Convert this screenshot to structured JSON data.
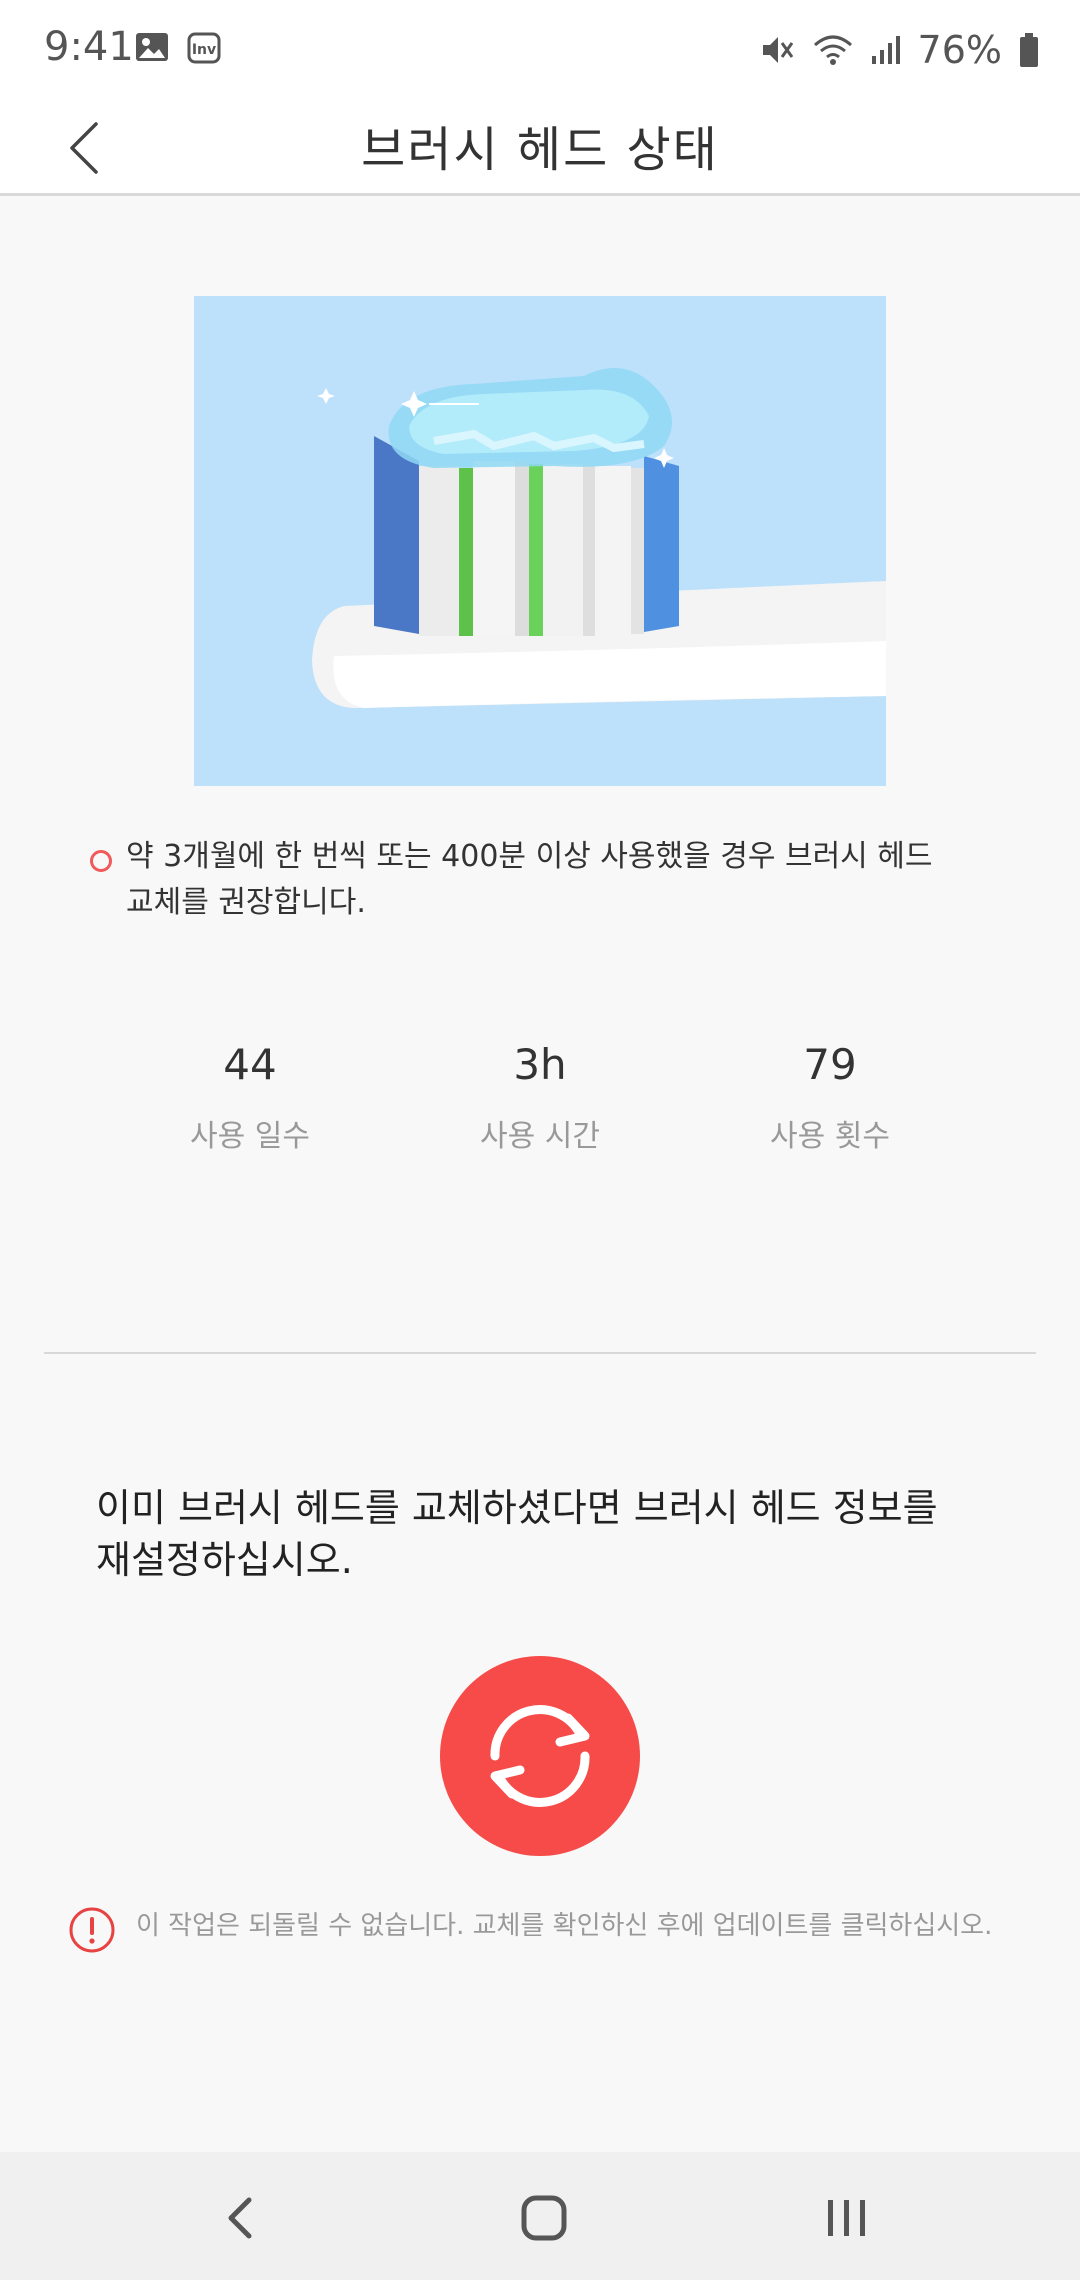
{
  "status_bar": {
    "time": "9:41",
    "battery": "76%"
  },
  "header": {
    "title": "브러시 헤드 상태"
  },
  "notice": {
    "text_line1": "약 3개월에 한 번씩 또는 400분 이상 사용했을 경우 브러시 헤드",
    "text_line2": "교체를 권장합니다."
  },
  "stats": [
    {
      "value": "44",
      "label": "사용 일수"
    },
    {
      "value": "3h",
      "label": "사용 시간"
    },
    {
      "value": "79",
      "label": "사용 횟수"
    }
  ],
  "reset": {
    "message_line1": "이미 브러시 헤드를 교체하셨다면 브러시 헤드 정보를",
    "message_line2": "재설정하십시오."
  },
  "warning": {
    "text": "이 작업은 되돌릴 수 없습니다. 교체를 확인하신 후에 업데이트를 클릭하십시오."
  },
  "colors": {
    "accent": "#f64b48",
    "hero_bg": "#bde0fb",
    "warning": "#e84343"
  },
  "icons": [
    "gallery-icon",
    "inv-app-icon",
    "mute-icon",
    "wifi-icon",
    "signal-icon",
    "battery-icon",
    "back-chevron-icon",
    "refresh-icon",
    "alert-circle-icon",
    "nav-back-icon",
    "nav-home-icon",
    "nav-recents-icon"
  ]
}
